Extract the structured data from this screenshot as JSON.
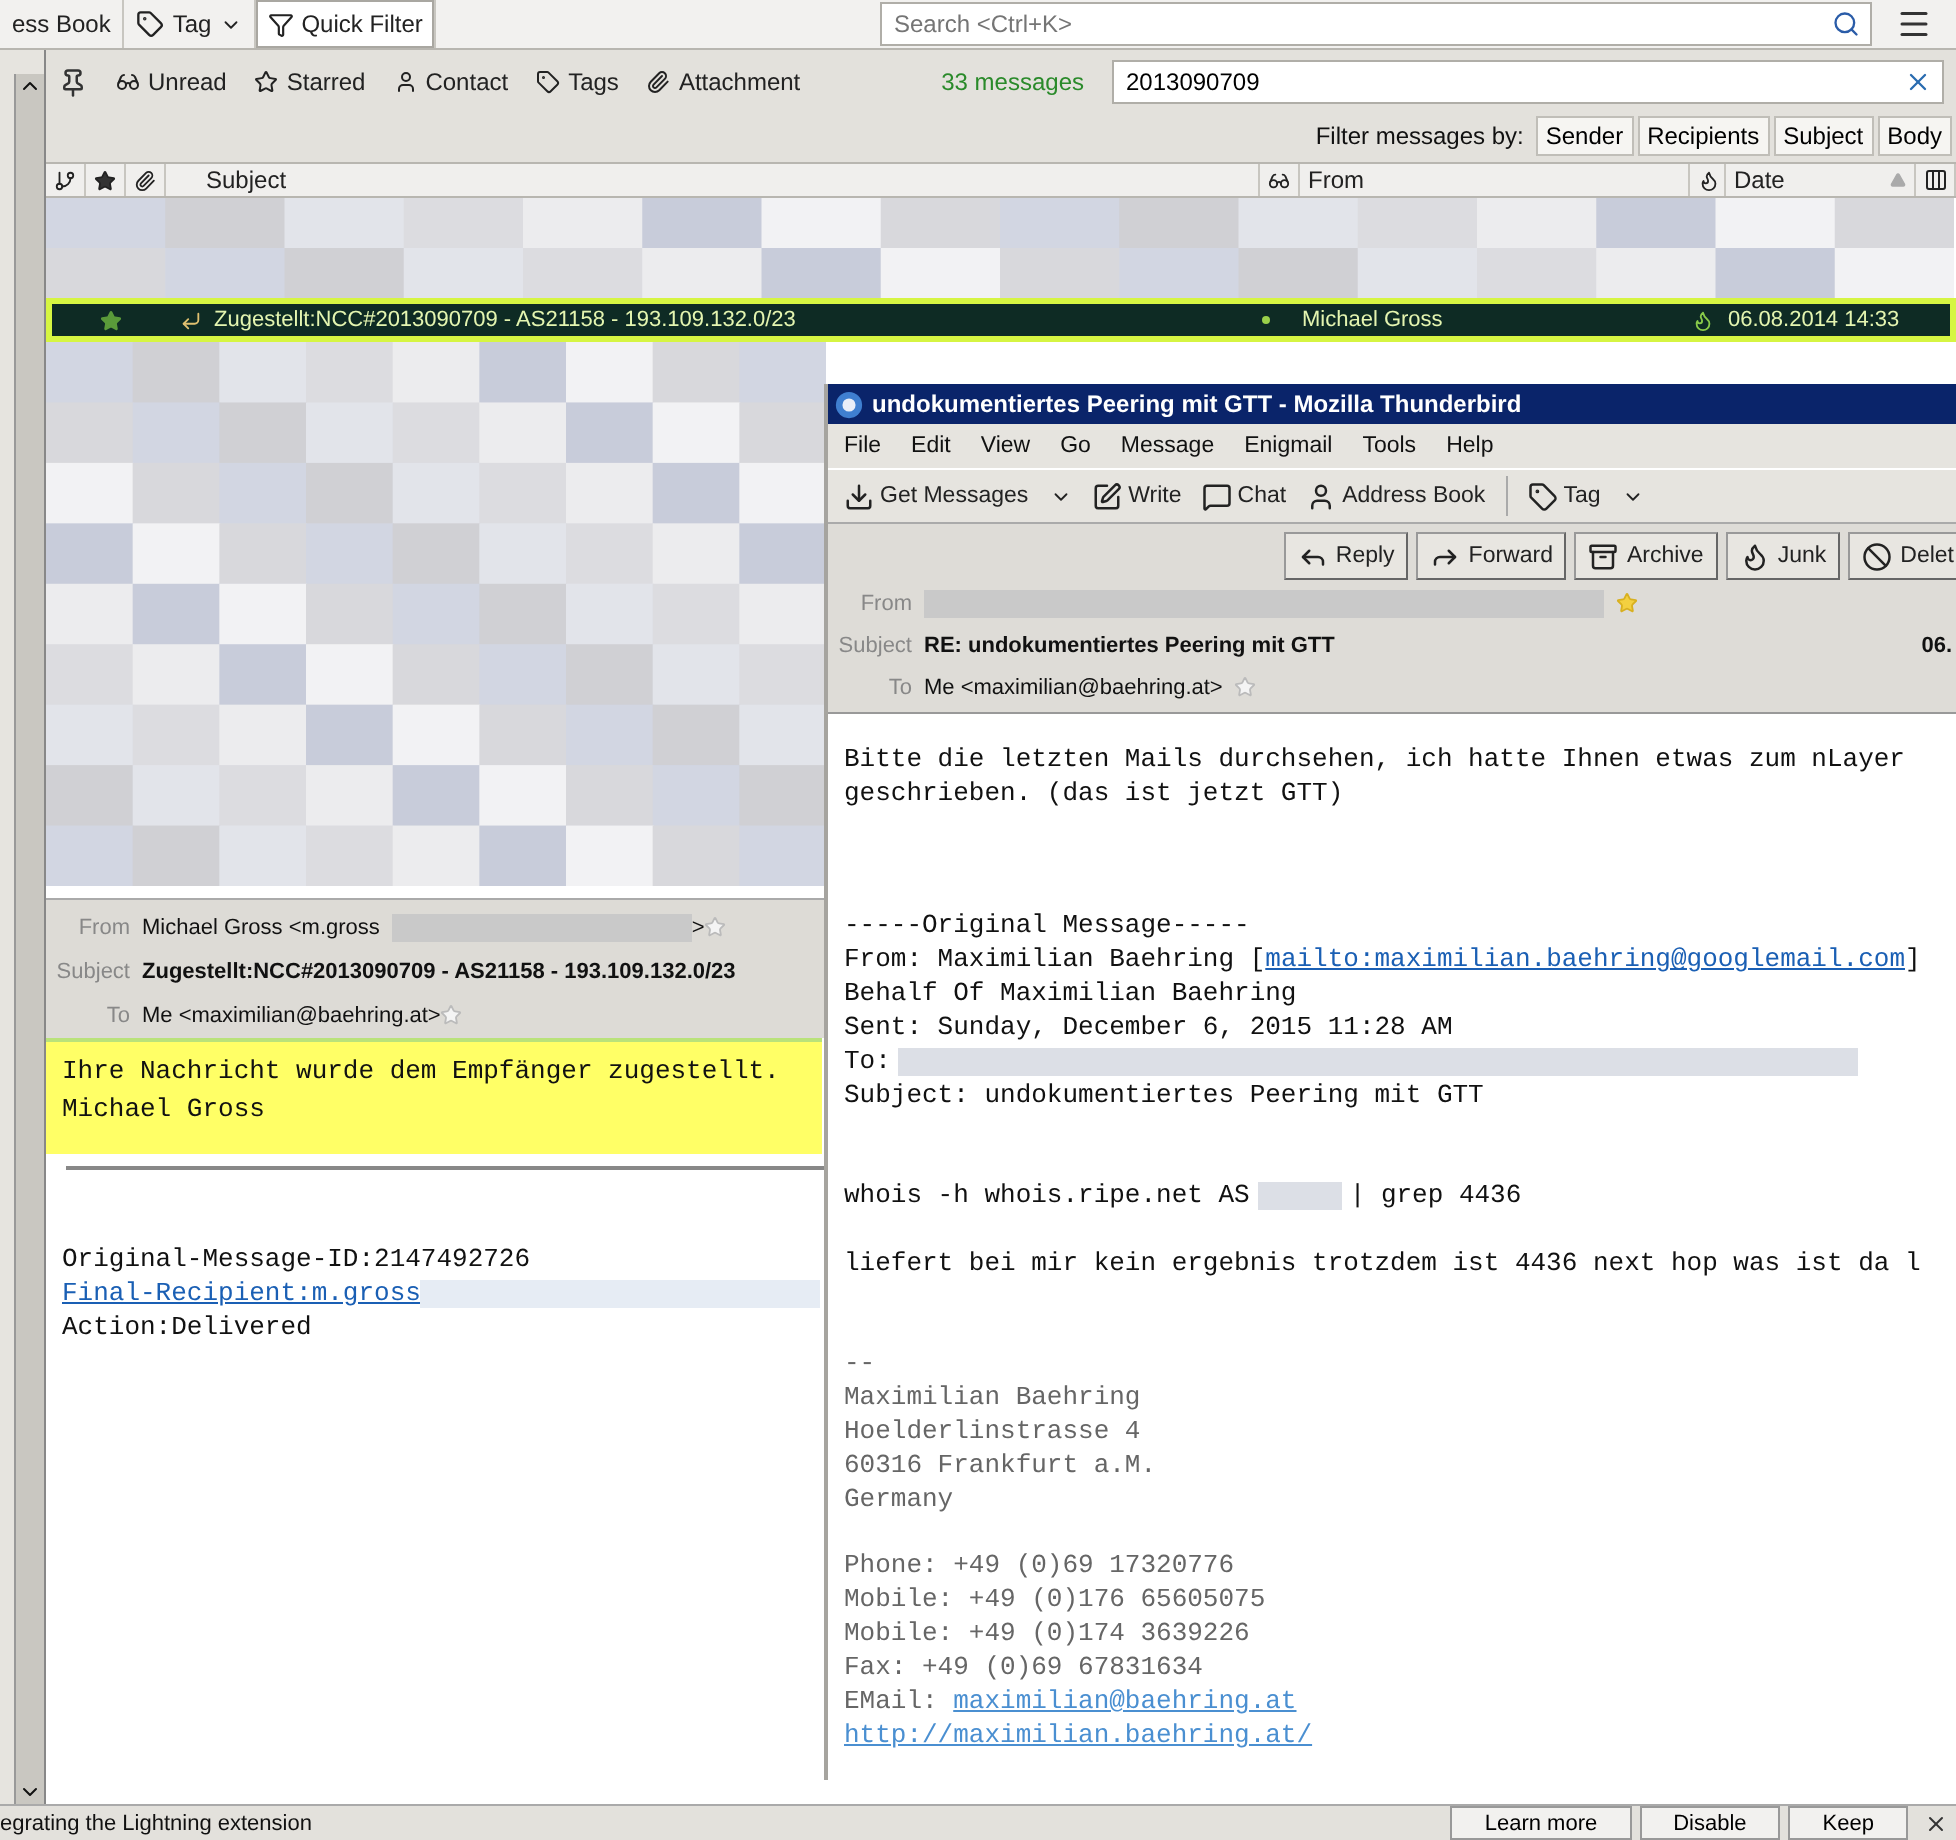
{
  "main_toolbar": {
    "address_book": "ess Book",
    "tag": "Tag",
    "quick_filter": {
      "label": "Quick Filter",
      "selected": true
    },
    "search": {
      "placeholder": "Search <Ctrl+K>"
    }
  },
  "quick_filter": {
    "toggles": [
      {
        "label": "Unread",
        "kind": "unread"
      },
      {
        "label": "Starred",
        "kind": "starred"
      },
      {
        "label": "Contact",
        "kind": "contact"
      },
      {
        "label": "Tags",
        "kind": "tags"
      },
      {
        "label": "Attachment",
        "kind": "attachment"
      }
    ],
    "count": "33 messages",
    "filter_value": "2013090709",
    "filter_by_label": "Filter messages by:",
    "filter_by": [
      "Sender",
      "Recipients",
      "Subject",
      "Body"
    ]
  },
  "message_list": {
    "columns": {
      "subject": "Subject",
      "from": "From",
      "date": "Date"
    },
    "rows": [
      {
        "selected": true,
        "starred": true,
        "replied": true,
        "subject": "Zugestellt:NCC#2013090709 - AS21158 - 193.109.132.0/23",
        "from": "Michael Gross",
        "date": "06.08.2014 14:33"
      }
    ]
  },
  "preview": {
    "headers": [
      {
        "label": "From",
        "value": "Michael Gross <m.gross",
        "redacted": true,
        "after": ">",
        "star": true
      },
      {
        "label": "Subject",
        "value": "Zugestellt:NCC#2013090709 - AS21158 - 193.109.132.0/23",
        "bold": true
      },
      {
        "label": "To",
        "value": "Me <maximilian@baehring.at>",
        "star": true
      }
    ],
    "quote": [
      "Ihre Nachricht wurde dem Empfänger zugestellt.",
      "Michael Gross"
    ],
    "body": [
      {
        "kind": "text",
        "text": "Original-Message-ID:2147492726"
      },
      {
        "kind": "link",
        "text": "Final-Recipient:m.gross",
        "redacted": true
      },
      {
        "kind": "text",
        "text": "Action:Delivered"
      }
    ]
  },
  "status_bar": {
    "text": "egrating the Lightning extension",
    "buttons": [
      "Learn more",
      "Disable",
      "Keep"
    ]
  },
  "message_window": {
    "title": "undokumentiertes Peering mit GTT - Mozilla Thunderbird",
    "menu": [
      "File",
      "Edit",
      "View",
      "Go",
      "Message",
      "Enigmail",
      "Tools",
      "Help"
    ],
    "toolbar": [
      {
        "label": "Get Messages",
        "kind": "get"
      },
      {
        "label": "Write",
        "kind": "write"
      },
      {
        "label": "Chat",
        "kind": "chat"
      },
      {
        "label": "Address Book",
        "kind": "contacts"
      },
      {
        "label": "Tag",
        "kind": "tag"
      }
    ],
    "actions": [
      {
        "label": "Reply",
        "kind": "reply"
      },
      {
        "label": "Forward",
        "kind": "forward"
      },
      {
        "label": "Archive",
        "kind": "archive"
      },
      {
        "label": "Junk",
        "kind": "junk"
      },
      {
        "label": "Delet",
        "kind": "delete"
      }
    ],
    "headers": [
      {
        "label": "From",
        "redacted": true,
        "star": true
      },
      {
        "label": "Subject",
        "value": "RE: undokumentiertes Peering mit GTT",
        "bold": true,
        "date": "06."
      },
      {
        "label": "To",
        "value": "Me <maximilian@baehring.at>",
        "star": true
      }
    ],
    "body": [
      {
        "kind": "text",
        "segments": [
          {
            "kind": "text",
            "text": "Bitte die letzten Mails durchsehen, ich hatte Ihnen etwas zum nLayer"
          }
        ]
      },
      {
        "kind": "text",
        "segments": [
          {
            "kind": "text",
            "text": "geschrieben. (das ist jetzt GTT)"
          }
        ]
      },
      {
        "kind": "blank"
      },
      {
        "kind": "blank"
      },
      {
        "kind": "blank"
      },
      {
        "kind": "text",
        "segments": [
          {
            "kind": "text",
            "text": "-----Original Message-----"
          }
        ]
      },
      {
        "kind": "text",
        "segments": [
          {
            "kind": "text",
            "text": "From: Maximilian Baehring ["
          },
          {
            "kind": "link",
            "text": "mailto:maximilian.baehring@googlemail.com"
          },
          {
            "kind": "text",
            "text": "]"
          }
        ]
      },
      {
        "kind": "text",
        "segments": [
          {
            "kind": "text",
            "text": "Behalf Of Maximilian Baehring"
          }
        ]
      },
      {
        "kind": "text",
        "segments": [
          {
            "kind": "text",
            "text": "Sent: Sunday, December 6, 2015 11:28 AM"
          }
        ]
      },
      {
        "kind": "text",
        "segments": [
          {
            "kind": "text",
            "text": "To:"
          },
          {
            "kind": "redacted"
          }
        ]
      },
      {
        "kind": "text",
        "segments": [
          {
            "kind": "text",
            "text": "Subject: undokumentiertes Peering mit GTT"
          }
        ]
      },
      {
        "kind": "blank"
      },
      {
        "kind": "blank"
      },
      {
        "kind": "text",
        "segments": [
          {
            "kind": "text",
            "text": "whois -h whois.ripe.net AS"
          },
          {
            "kind": "redacted"
          },
          {
            "kind": "text",
            "text": "| grep 4436"
          }
        ]
      },
      {
        "kind": "blank"
      },
      {
        "kind": "text",
        "segments": [
          {
            "kind": "text",
            "text": "liefert bei mir kein ergebnis trotzdem ist 4436 next hop was ist da l"
          }
        ]
      },
      {
        "kind": "blank"
      },
      {
        "kind": "blank"
      },
      {
        "kind": "signature",
        "segments": [
          {
            "kind": "text",
            "text": "--"
          }
        ]
      },
      {
        "kind": "signature",
        "segments": [
          {
            "kind": "text",
            "text": "Maximilian Baehring"
          }
        ]
      },
      {
        "kind": "signature",
        "segments": [
          {
            "kind": "text",
            "text": "Hoelderlinstrasse 4"
          }
        ]
      },
      {
        "kind": "signature",
        "segments": [
          {
            "kind": "text",
            "text": "60316 Frankfurt a.M."
          }
        ]
      },
      {
        "kind": "signature",
        "segments": [
          {
            "kind": "text",
            "text": "Germany"
          }
        ]
      },
      {
        "kind": "blank"
      },
      {
        "kind": "signature",
        "segments": [
          {
            "kind": "text",
            "text": "Phone: +49 (0)69 17320776"
          }
        ]
      },
      {
        "kind": "signature",
        "segments": [
          {
            "kind": "text",
            "text": "Mobile: +49 (0)176 65605075"
          }
        ]
      },
      {
        "kind": "signature",
        "segments": [
          {
            "kind": "text",
            "text": "Mobile: +49 (0)174 3639226"
          }
        ]
      },
      {
        "kind": "signature",
        "segments": [
          {
            "kind": "text",
            "text": "Fax: +49 (0)69 67831634"
          }
        ]
      },
      {
        "kind": "signature",
        "segments": [
          {
            "kind": "text",
            "text": "EMail: "
          },
          {
            "kind": "link",
            "text": "maximilian@baehring.at"
          }
        ]
      },
      {
        "kind": "signature",
        "segments": [
          {
            "kind": "link",
            "text": "http://maximilian.baehring.at/"
          }
        ]
      }
    ]
  }
}
